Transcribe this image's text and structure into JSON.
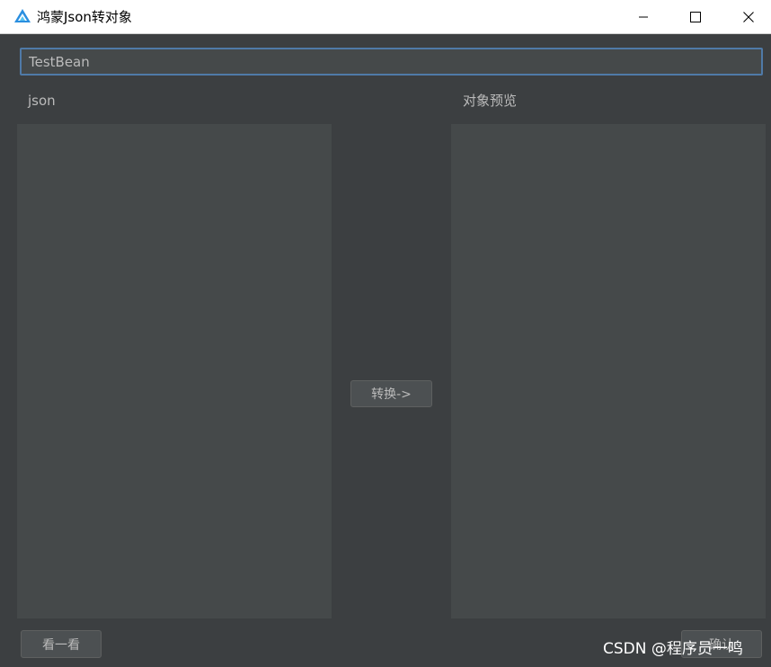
{
  "window": {
    "title": "鸿蒙Json转对象",
    "icon": "app-logo-icon",
    "controls": [
      "minimize-icon",
      "maximize-icon",
      "close-icon"
    ]
  },
  "class_name_field": {
    "value": "TestBean"
  },
  "json_panel": {
    "label": "json",
    "value": ""
  },
  "preview_panel": {
    "label": "对象预览",
    "value": ""
  },
  "buttons": {
    "convert": "转换->",
    "look": "看一看",
    "confirm": "确认"
  },
  "overlay": {
    "csdn_watermark": "CSDN @程序员一鸣"
  },
  "colors": {
    "background": "#3c3f41",
    "panel": "#45494a",
    "focus_border": "#4f7aa8",
    "text": "#bbbbbb",
    "button": "#4c5052"
  }
}
